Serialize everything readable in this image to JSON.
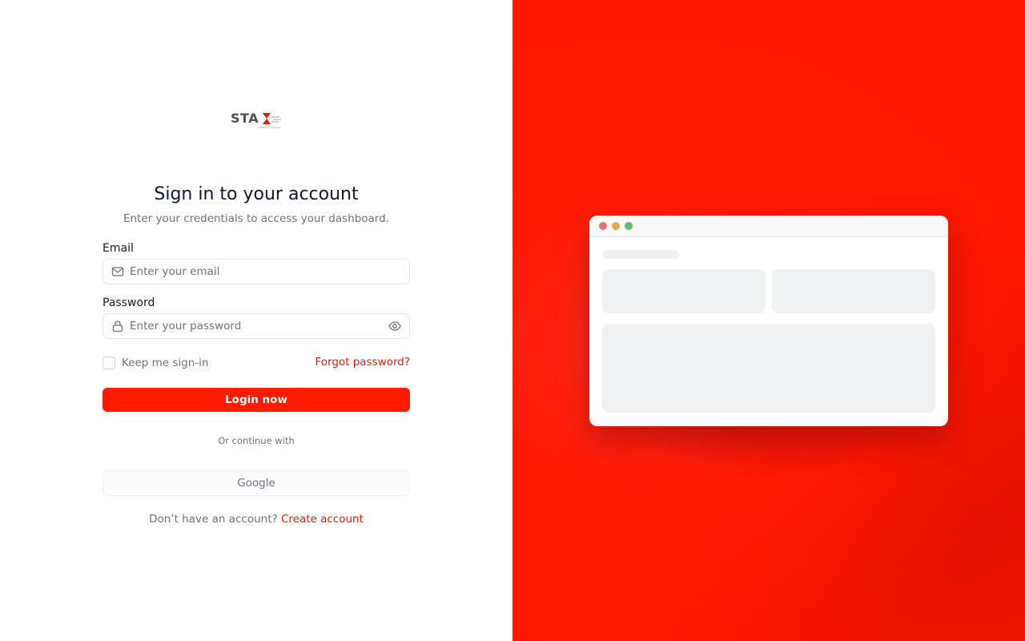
{
  "brand": {
    "logo_text": "STA",
    "logo_subtext": "Software Company",
    "accent_color": "#ff1a00"
  },
  "login": {
    "title": "Sign in to your account",
    "subtitle": "Enter your credentials to access your dashboard.",
    "email": {
      "label": "Email",
      "placeholder": "Enter your email",
      "value": "",
      "icon": "mail-icon"
    },
    "password": {
      "label": "Password",
      "placeholder": "Enter your password",
      "value": "",
      "icon": "lock-icon",
      "toggle_icon": "eye-icon"
    },
    "remember_label": "Keep me sign-in",
    "remember_checked": false,
    "forgot_label": "Forgot password?",
    "login_button": "Login now",
    "divider_text": "Or continue with",
    "google_button": "Google",
    "signup_prompt": "Don’t have an account?",
    "signup_link": "Create account"
  },
  "preview": {
    "window_dots": [
      "#e57373",
      "#e8a552",
      "#66bb6a"
    ],
    "background_color": "#ff1600"
  }
}
